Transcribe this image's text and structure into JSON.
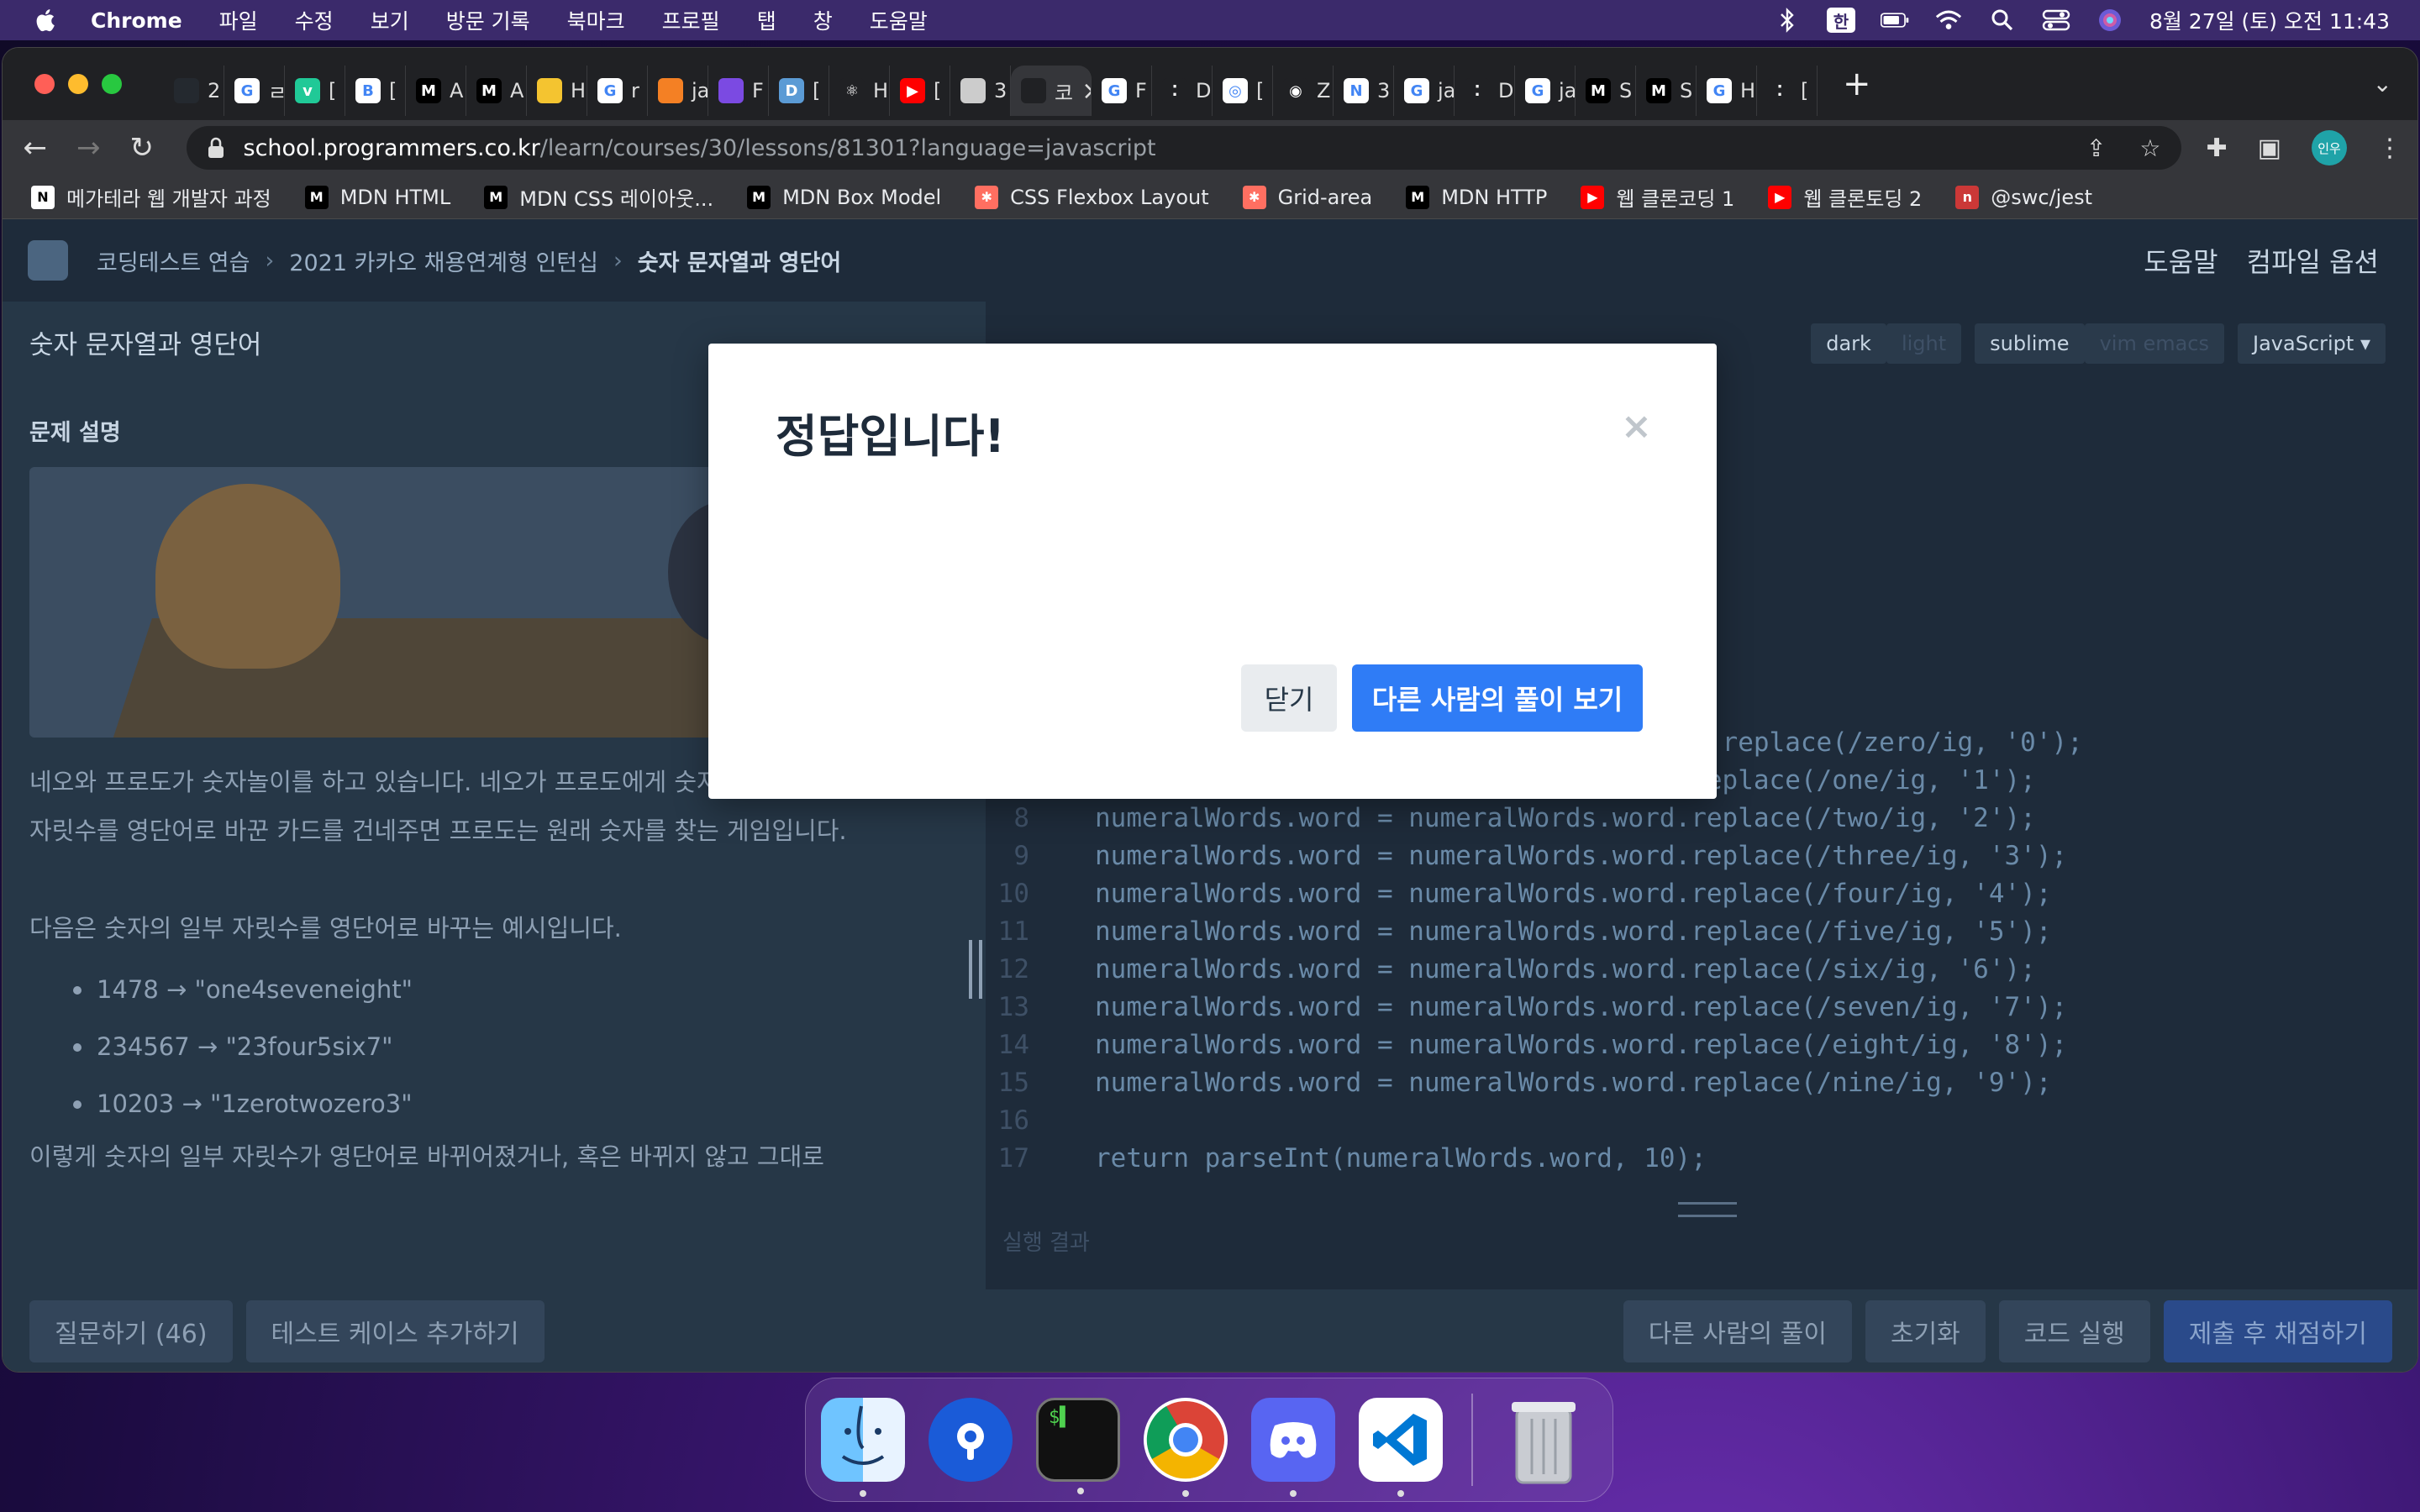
{
  "menubar": {
    "app": "Chrome",
    "items": [
      "파일",
      "수정",
      "보기",
      "방문 기록",
      "북마크",
      "프로필",
      "탭",
      "창",
      "도움말"
    ],
    "ime": "한",
    "clock": "8월 27일 (토) 오전 11:43"
  },
  "tabs": [
    {
      "label": "2",
      "icon": "github-icon",
      "color": "#24292f",
      "glyph": ""
    },
    {
      "label": "ㄹ",
      "icon": "google-icon",
      "color": "#fff",
      "glyph": "G"
    },
    {
      "label": "[",
      "icon": "velog-icon",
      "color": "#20c997",
      "glyph": "v"
    },
    {
      "label": "[",
      "icon": "bbak-icon",
      "color": "#fff",
      "glyph": "B"
    },
    {
      "label": "A",
      "icon": "mdn-icon",
      "color": "#000",
      "glyph": "M"
    },
    {
      "label": "A",
      "icon": "mdn-icon",
      "color": "#000",
      "glyph": "M"
    },
    {
      "label": "H",
      "icon": "emoji-icon",
      "color": "#f4c430",
      "glyph": ""
    },
    {
      "label": "r",
      "icon": "google-icon",
      "color": "#fff",
      "glyph": "G"
    },
    {
      "label": "ja",
      "icon": "stackoverflow-icon",
      "color": "#f48024",
      "glyph": ""
    },
    {
      "label": "F",
      "icon": "rocket-icon",
      "color": "#7b4ae2",
      "glyph": ""
    },
    {
      "label": "[",
      "icon": "dale-icon",
      "color": "#5b9bd5",
      "glyph": "D"
    },
    {
      "label": "H",
      "icon": "react-icon",
      "color": "#202124",
      "glyph": "⚛"
    },
    {
      "label": "[",
      "icon": "youtube-icon",
      "color": "#ff0000",
      "glyph": "▶"
    },
    {
      "label": "3",
      "icon": "dice-icon",
      "color": "#ccc",
      "glyph": ""
    },
    {
      "label": "코",
      "icon": "programmers-icon",
      "color": "#202124",
      "glyph": "",
      "active": true
    },
    {
      "label": "F",
      "icon": "google-icon",
      "color": "#fff",
      "glyph": "G"
    },
    {
      "label": "D",
      "icon": "dots-icon",
      "color": "#202124",
      "glyph": "⁚"
    },
    {
      "label": "[",
      "icon": "openai-icon",
      "color": "#fff",
      "glyph": "◎"
    },
    {
      "label": "Z",
      "icon": "record-icon",
      "color": "#202124",
      "glyph": "◉"
    },
    {
      "label": "3",
      "icon": "notion-icon",
      "color": "#fff",
      "glyph": "N"
    },
    {
      "label": "ja",
      "icon": "google-icon",
      "color": "#fff",
      "glyph": "G"
    },
    {
      "label": "D",
      "icon": "dots-icon",
      "color": "#202124",
      "glyph": "⁚"
    },
    {
      "label": "ja",
      "icon": "google-icon",
      "color": "#fff",
      "glyph": "G"
    },
    {
      "label": "S",
      "icon": "mdn-icon",
      "color": "#000",
      "glyph": "M"
    },
    {
      "label": "S",
      "icon": "mdn-icon",
      "color": "#000",
      "glyph": "M"
    },
    {
      "label": "H",
      "icon": "google-icon",
      "color": "#fff",
      "glyph": "G"
    },
    {
      "label": "[",
      "icon": "dots-icon",
      "color": "#202124",
      "glyph": "⁚"
    }
  ],
  "address": {
    "host": "school.programmers.co.kr",
    "path": "/learn/courses/30/lessons/81301?language=javascript"
  },
  "profile": "인우",
  "bookmarks": [
    {
      "label": "메가테라 웹 개발자 과정",
      "icon": "notion-icon",
      "color": "#fff",
      "glyph": "N"
    },
    {
      "label": "MDN HTML",
      "icon": "mdn-icon",
      "color": "#000",
      "glyph": "M"
    },
    {
      "label": "MDN CSS 레이아웃...",
      "icon": "mdn-icon",
      "color": "#000",
      "glyph": "M"
    },
    {
      "label": "MDN Box Model",
      "icon": "mdn-icon",
      "color": "#000",
      "glyph": "M"
    },
    {
      "label": "CSS Flexbox Layout",
      "icon": "asterisk-icon",
      "color": "#ff6f61",
      "glyph": "✱"
    },
    {
      "label": "Grid-area",
      "icon": "asterisk-icon",
      "color": "#ff6f61",
      "glyph": "✱"
    },
    {
      "label": "MDN HTTP",
      "icon": "mdn-icon",
      "color": "#000",
      "glyph": "M"
    },
    {
      "label": "웹 클론코딩 1",
      "icon": "youtube-icon",
      "color": "#ff0000",
      "glyph": "▶"
    },
    {
      "label": "웹 클론토딩 2",
      "icon": "youtube-icon",
      "color": "#ff0000",
      "glyph": "▶"
    },
    {
      "label": "@swc/jest",
      "icon": "npm-icon",
      "color": "#cb3837",
      "glyph": "n"
    }
  ],
  "breadcrumb": [
    "코딩테스트 연습",
    "2021 카카오 채용연계형 인턴십",
    "숫자 문자열과 영단어"
  ],
  "header_right": [
    "도움말",
    "컴파일 옵션"
  ],
  "problem": {
    "title": "숫자 문자열과 영단어",
    "section": "문제 설명",
    "para1": "네오와 프로도가 숫자놀이를 하고 있습니다. 네오가 프로도에게 숫자를 건넬 때 일부 자릿수를 영단어로 바꾼 카드를 건네주면 프로도는 원래 숫자를 찾는 게임입니다.",
    "para2": "다음은 숫자의 일부 자릿수를 영단어로 바꾸는 예시입니다.",
    "examples": [
      "1478 → \"one4seveneight\"",
      "234567 → \"23four5six7\"",
      "10203 → \"1zerotwozero3\""
    ],
    "para3": "이렇게 숫자의 일부 자릿수가 영단어로 바뀌어졌거나, 혹은 바뀌지 않고 그대로"
  },
  "editor": {
    "theme_dark": "dark",
    "theme_light": "light",
    "keymap": "sublime",
    "keymap_alt": "vim emacs",
    "language": "JavaScript ▾",
    "lines": [
      {
        "n": "",
        "t": "                                       .replace(/zero/ig, '0');"
      },
      {
        "n": "7",
        "t": "numeralWords.word = numeralWords.word.replace(/one/ig, '1');"
      },
      {
        "n": "8",
        "t": "numeralWords.word = numeralWords.word.replace(/two/ig, '2');"
      },
      {
        "n": "9",
        "t": "numeralWords.word = numeralWords.word.replace(/three/ig, '3');"
      },
      {
        "n": "10",
        "t": "numeralWords.word = numeralWords.word.replace(/four/ig, '4');"
      },
      {
        "n": "11",
        "t": "numeralWords.word = numeralWords.word.replace(/five/ig, '5');"
      },
      {
        "n": "12",
        "t": "numeralWords.word = numeralWords.word.replace(/six/ig, '6');"
      },
      {
        "n": "13",
        "t": "numeralWords.word = numeralWords.word.replace(/seven/ig, '7');"
      },
      {
        "n": "14",
        "t": "numeralWords.word = numeralWords.word.replace(/eight/ig, '8');"
      },
      {
        "n": "15",
        "t": "numeralWords.word = numeralWords.word.replace(/nine/ig, '9');"
      },
      {
        "n": "16",
        "t": ""
      },
      {
        "n": "17",
        "t": "return parseInt(numeralWords.word, 10);"
      }
    ],
    "result_label": "실행 결과"
  },
  "footer": {
    "question": "질문하기 (46)",
    "add_test": "테스트 케이스 추가하기",
    "others": "다른 사람의 풀이",
    "reset": "초기화",
    "run": "코드 실행",
    "submit": "제출 후 채점하기"
  },
  "modal": {
    "title": "정답입니다!",
    "close_label": "닫기",
    "primary_label": "다른 사람의 풀이 보기",
    "close_glyph": "×"
  },
  "dock": [
    "finder-icon",
    "pock-icon",
    "terminal-icon",
    "chrome-icon",
    "discord-icon",
    "vscode-icon",
    "trash-icon"
  ],
  "colors": {
    "accent": "#2f7cf6",
    "page_bg": "#263747"
  }
}
